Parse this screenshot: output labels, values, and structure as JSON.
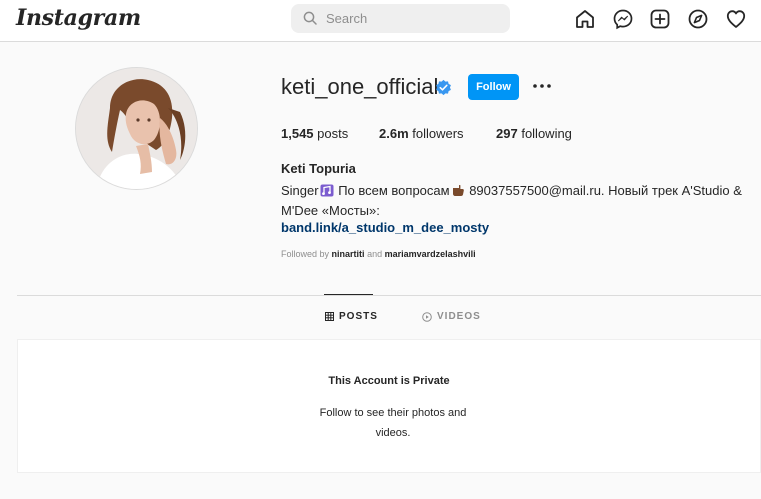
{
  "header": {
    "logo": "Instagram",
    "search_placeholder": "Search",
    "nav_icons": [
      "home-icon",
      "messenger-icon",
      "new-post-icon",
      "explore-icon",
      "activity-heart-icon"
    ]
  },
  "profile": {
    "username": "keti_one_official",
    "verified": true,
    "follow_label": "Follow",
    "stats": {
      "posts_count": "1,545",
      "posts_label": "posts",
      "followers_count": "2.6m",
      "followers_label": "followers",
      "following_count": "297",
      "following_label": "following"
    },
    "full_name": "Keti Topuria",
    "bio_part1": "Singer",
    "bio_part2": " По всем вопросам",
    "bio_part3": " 89037557500@mail.ru. Новый трек A'Studio & M'Dee «Мосты»:",
    "link": "band.link/a_studio_m_dee_mosty",
    "followed_prefix": "Followed by",
    "followed_user1": "ninartiti",
    "followed_and": "and",
    "followed_user2": "mariamvardzelashvili"
  },
  "tabs": [
    {
      "label": "POSTS",
      "icon": "grid-icon",
      "active": true
    },
    {
      "label": "VIDEOS",
      "icon": "play-circle-icon",
      "active": false
    }
  ],
  "private": {
    "title": "This Account is Private",
    "message": "Follow to see their photos and videos."
  },
  "colors": {
    "follow_blue": "#0095f6",
    "link_blue": "#00376b",
    "verified_blue": "#3897f0",
    "muted": "#8e8e8e"
  }
}
